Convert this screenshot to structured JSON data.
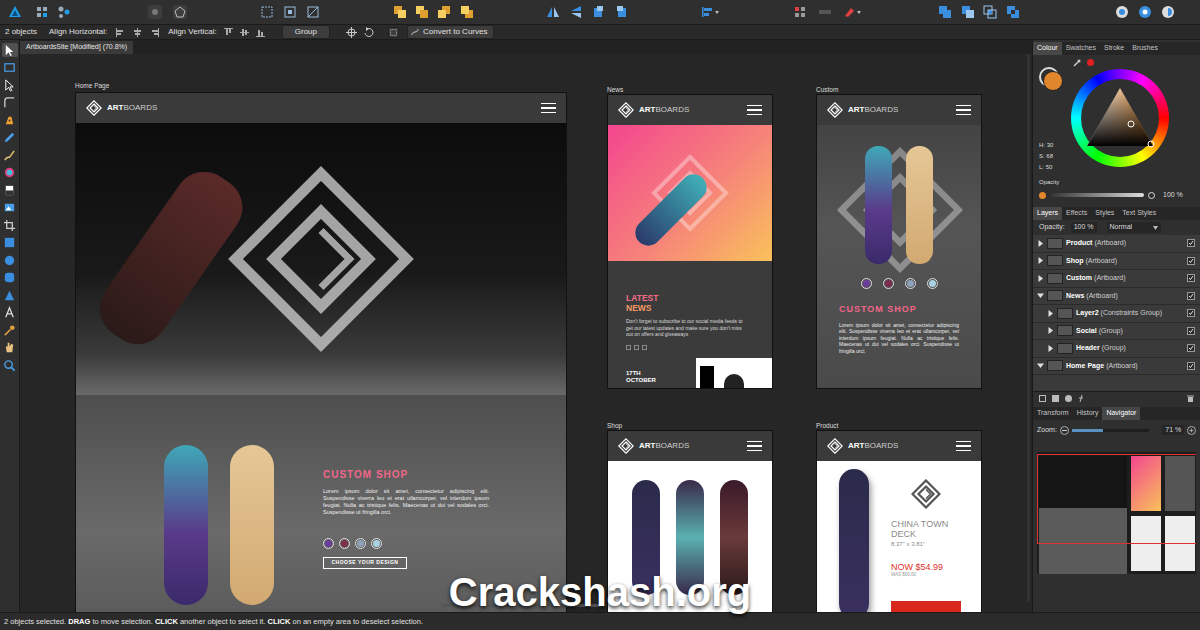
{
  "context_bar": {
    "selection": "2 objects",
    "align_horizontal": "Align Horizontal:",
    "align_vertical": "Align Vertical:",
    "group_button": "Group",
    "convert_button": "Convert to Curves"
  },
  "document_tab": "ArtboardsSite [Modified] (70.8%)",
  "tools": [
    {
      "selected": true
    },
    {
      "selected": false
    },
    {
      "selected": false
    },
    {
      "selected": false
    },
    {
      "selected": false
    },
    {
      "selected": false
    },
    {
      "selected": false
    },
    {
      "selected": false
    },
    {
      "selected": false
    },
    {
      "selected": false
    },
    {
      "selected": false
    },
    {
      "selected": false
    },
    {
      "selected": false
    },
    {
      "selected": false
    },
    {
      "selected": false
    },
    {
      "selected": false
    },
    {
      "selected": false
    },
    {
      "selected": false
    },
    {
      "selected": false
    }
  ],
  "artboards": {
    "logo": {
      "bold": "ART",
      "light": "BOARDS"
    },
    "home": {
      "label": "Home Page",
      "heading": "CUSTOM SHOP",
      "body": "Lorem ipsum dolor sit amet, consectetur adipiscing elit. Suspendisse viverra leo et erat ullamcorper, vel interdum ipsum feugiat. Nulla ac tristique felis. Maecenas ut dui vel sodales orci. Suspendisse ut fringilla orci.",
      "swatches": [
        {
          "color": "#6a3d9a"
        },
        {
          "color": "#7b2e4e"
        },
        {
          "color": "#8da2b8"
        },
        {
          "color": "#a9d3e2"
        }
      ],
      "button": "CHOOSE YOUR DESIGN"
    },
    "news": {
      "label": "News",
      "heading_1": "LATEST",
      "heading_2": "NEWS",
      "body": "Don't forget to subscribe to our social media feeds to get our latest updates and make sure you don't miss out on offers and giveaways",
      "date_1": "17TH",
      "date_2": "OCTOBER"
    },
    "custom": {
      "label": "Custom",
      "heading": "CUSTOM SHOP",
      "body": "Lorem ipsum dolor sit amet, consectetur adipiscing elit. Suspendisse viverra leo et erat ullamcorper, vel interdum ipsum feugiat. Nulla ac tristique felis. Maecenas ut dui vel sodales orci. Suspendisse ut fringilla orci.",
      "swatches": [
        {
          "color": "#6a3d9a"
        },
        {
          "color": "#7b2e4e"
        },
        {
          "color": "#8da2b8"
        },
        {
          "color": "#a9d3e2"
        }
      ]
    },
    "shop": {
      "label": "Shop"
    },
    "product": {
      "label": "Product",
      "title_1": "CHINA TOWN",
      "title_2": "DECK",
      "size": "8.37\" x 3.81\"",
      "price": "NOW $54.99",
      "was": "WAS $60.00"
    }
  },
  "colour_panel": {
    "tabs": [
      {
        "label": "Colour",
        "selected": true
      },
      {
        "label": "Swatches",
        "selected": false
      },
      {
        "label": "Stroke",
        "selected": false
      },
      {
        "label": "Brushes",
        "selected": false
      }
    ],
    "fill_color": "#e0862c",
    "hue": "H: 30",
    "saturation": "S: 68",
    "lightness": "L: 50",
    "opacity_label": "Opacity",
    "opacity_level": 1,
    "opacity_value": "100 %"
  },
  "layers_panel": {
    "tabs": [
      {
        "label": "Layers",
        "selected": true
      },
      {
        "label": "Effects",
        "selected": false
      },
      {
        "label": "Styles",
        "selected": false
      },
      {
        "label": "Text Styles",
        "selected": false
      }
    ],
    "opacity_label": "Opacity:",
    "opacity_value": "100 %",
    "blend_mode": "Normal",
    "layers": [
      {
        "name": "Product",
        "type": "(Artboard)",
        "depth": 0,
        "expanded": false,
        "visible": true
      },
      {
        "name": "Shop",
        "type": "(Artboard)",
        "depth": 0,
        "expanded": false,
        "visible": true
      },
      {
        "name": "Custom",
        "type": "(Artboard)",
        "depth": 0,
        "expanded": false,
        "visible": true
      },
      {
        "name": "News",
        "type": "(Artboard)",
        "depth": 0,
        "expanded": true,
        "visible": true
      },
      {
        "name": "Layer2",
        "type": "(Constraints Group)",
        "depth": 1,
        "expanded": false,
        "visible": true
      },
      {
        "name": "Social",
        "type": "(Group)",
        "depth": 1,
        "expanded": false,
        "visible": true
      },
      {
        "name": "Header",
        "type": "(Group)",
        "depth": 1,
        "expanded": false,
        "visible": true
      },
      {
        "name": "Home Page",
        "type": "(Artboard)",
        "depth": 0,
        "expanded": true,
        "visible": true
      }
    ]
  },
  "navigator_panel": {
    "tabs": [
      {
        "label": "Transform",
        "selected": false
      },
      {
        "label": "History",
        "selected": false
      },
      {
        "label": "Navigator",
        "selected": true
      }
    ],
    "zoom_label": "Zoom:",
    "zoom_level": 0.4,
    "zoom_value": "71 %"
  },
  "status_bar": [
    {
      "text": "2 objects selected. ",
      "bold": false
    },
    {
      "text": "DRAG",
      "bold": true
    },
    {
      "text": " to move selection. ",
      "bold": false
    },
    {
      "text": "CLICK",
      "bold": true
    },
    {
      "text": " another object to select it. ",
      "bold": false
    },
    {
      "text": "CLICK",
      "bold": true
    },
    {
      "text": " on an empty area to deselect selection.",
      "bold": false
    }
  ],
  "watermark": "Crackshash.org"
}
